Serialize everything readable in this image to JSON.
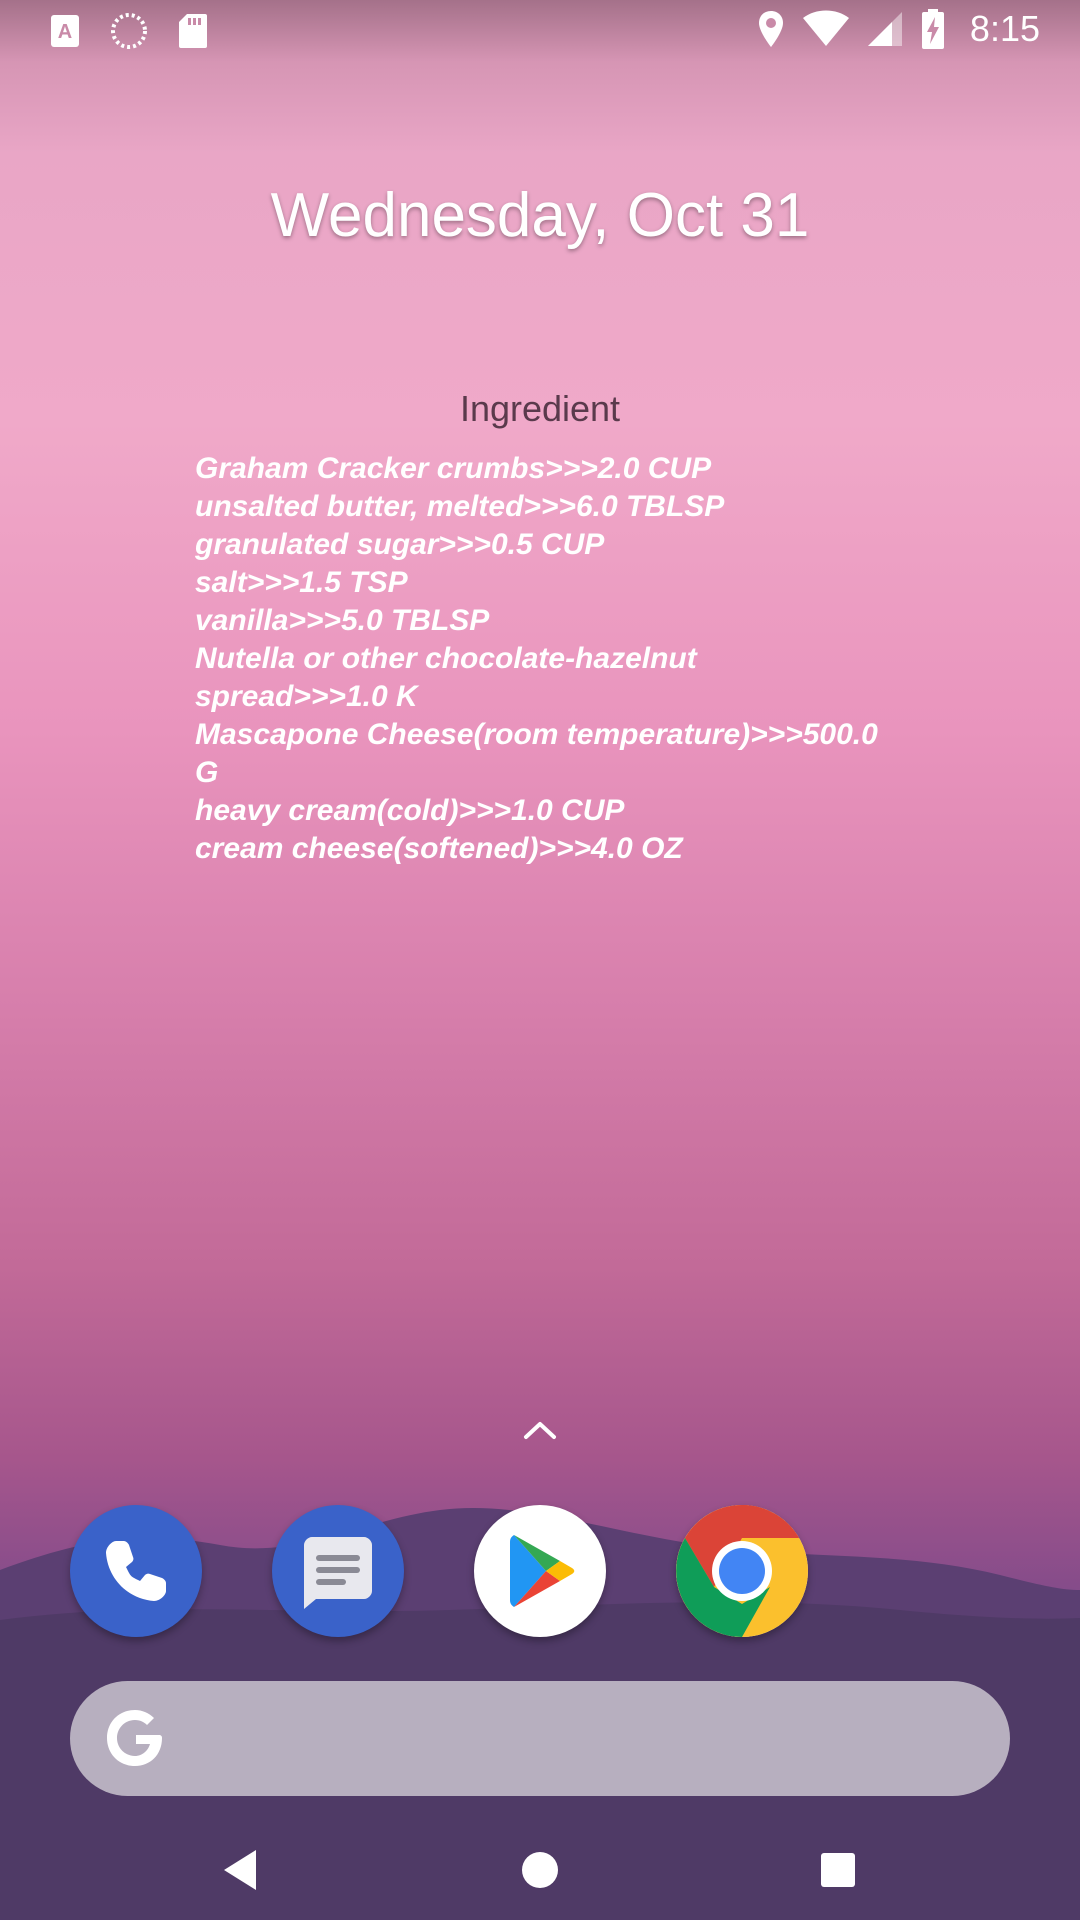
{
  "status_bar": {
    "time": "8:15",
    "left_icons": [
      "a-notification-icon",
      "loading-icon",
      "sd-card-icon"
    ],
    "right_icons": [
      "location-icon",
      "wifi-icon",
      "signal-icon",
      "battery-charging-icon"
    ]
  },
  "home": {
    "date": "Wednesday, Oct 31"
  },
  "widget": {
    "title": "Ingredient",
    "lines": [
      "Graham Cracker crumbs>>>2.0 CUP",
      "unsalted butter, melted>>>6.0 TBLSP",
      "granulated sugar>>>0.5 CUP",
      "salt>>>1.5 TSP",
      "vanilla>>>5.0 TBLSP",
      "Nutella or other chocolate-hazelnut",
      "spread>>>1.0 K",
      "Mascapone Cheese(room temperature)>>>500.0",
      "G",
      "heavy cream(cold)>>>1.0 CUP",
      "cream cheese(softened)>>>4.0 OZ"
    ]
  },
  "dock": {
    "apps": [
      "phone-icon",
      "messages-icon",
      "play-store-icon",
      "chrome-icon"
    ]
  },
  "search": {
    "icon": "google-g-icon"
  },
  "nav": {
    "buttons": [
      "back-icon",
      "home-icon",
      "recents-icon"
    ]
  },
  "colors": {
    "widget_title": "#5a3a4c",
    "search_bg": "#b7afbf",
    "dock_blue": "#3a62c9"
  }
}
